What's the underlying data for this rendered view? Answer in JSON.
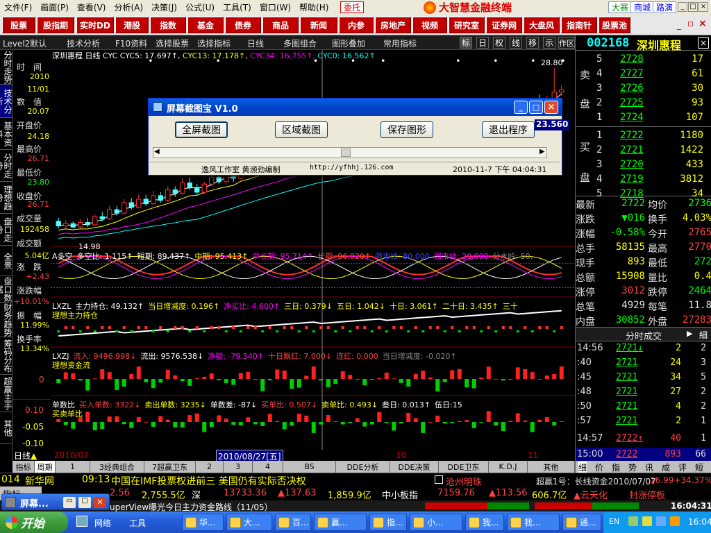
{
  "menu": {
    "items": [
      "文件(F)",
      "画面(P)",
      "查看(V)",
      "分析(A)",
      "决策(J)",
      "公式(U)",
      "工具(T)",
      "窗口(W)",
      "帮助(H)"
    ],
    "trade_btn": "委托",
    "app_title": "大智慧金融终端",
    "right_btns": [
      "大赛",
      "商城",
      "路演"
    ],
    "win_ctrls": [
      "_",
      "□",
      "×"
    ]
  },
  "modules": [
    "股票",
    "股指期",
    "实时DD",
    "港股",
    "指数",
    "基金",
    "债券",
    "商品",
    "新闻",
    "内参",
    "房地产",
    "视频",
    "研究室",
    "证券网",
    "大盘风",
    "指南针",
    "股票池"
  ],
  "toolbar2": {
    "items": [
      "Level2默认",
      "技术分析",
      "F10资料",
      "选择股票",
      "选择指标",
      "日线",
      "多图组合",
      "图形叠加",
      "常用指标"
    ],
    "square_btns": [
      "标",
      "日",
      "权",
      "线",
      "移",
      "示",
      "作区"
    ]
  },
  "left_tabs": [
    "分时走势",
    "技术分析",
    "基本资料",
    "分时走势",
    "理想趋势",
    "盘口走势",
    "全景",
    "盘口数据",
    "财务趋势",
    "筹码分布",
    "超赢主手",
    "其他"
  ],
  "info": {
    "labels": [
      "时　间",
      "数　值",
      "开盘价",
      "最高价",
      "最低价",
      "收盘价",
      "成交量",
      "成交额",
      "涨　跌",
      "涨跌幅",
      "振　幅",
      "换手率"
    ],
    "values": [
      "2010",
      "11/01",
      "20.07",
      "24.18",
      "26.71",
      "23.80",
      "26.71",
      "192458",
      "5.04亿",
      "+2.43",
      "+10.01%",
      "11.99%",
      "13.34%"
    ]
  },
  "chart_data": {
    "type": "candlestick",
    "title": "深圳惠程 日线",
    "indicators": [
      {
        "name": "CYC",
        "color": "#ffffff",
        "label": "CYC"
      },
      {
        "name": "CYC5",
        "value": "17.697",
        "color": "#ffffff"
      },
      {
        "name": "CYC13",
        "value": "17.178",
        "color": "#ffff00"
      },
      {
        "name": "CYC34",
        "value": "16.755",
        "color": "#ff00ff"
      },
      {
        "name": "CYC0",
        "value": "16.562",
        "color": "#00ffff"
      }
    ],
    "price_labels": [
      "28.80",
      "23.560",
      "14.98"
    ],
    "x_labels": [
      "2010/07",
      "2010/08/27[五]",
      "10",
      "11"
    ],
    "day_label": "日线",
    "candles": [
      [
        15.6,
        15.2,
        15.9,
        15.0
      ],
      [
        15.2,
        15.4,
        15.7,
        14.98
      ],
      [
        15.4,
        15.1,
        15.6,
        15.0
      ],
      [
        15.1,
        15.5,
        15.8,
        15.0
      ],
      [
        15.5,
        15.3,
        15.9,
        15.1
      ],
      [
        15.3,
        16.0,
        16.2,
        15.2
      ],
      [
        16.0,
        15.8,
        16.4,
        15.6
      ],
      [
        15.8,
        16.6,
        16.9,
        15.7
      ],
      [
        16.6,
        16.3,
        16.9,
        16.1
      ],
      [
        16.3,
        17.2,
        17.5,
        16.2
      ],
      [
        17.2,
        16.8,
        17.6,
        16.6
      ],
      [
        16.8,
        17.5,
        17.9,
        16.7
      ],
      [
        17.5,
        17.1,
        17.9,
        16.9
      ],
      [
        17.1,
        17.8,
        18.2,
        17.0
      ],
      [
        17.8,
        17.4,
        18.1,
        17.2
      ],
      [
        17.4,
        18.3,
        18.6,
        17.3
      ],
      [
        18.3,
        18.0,
        18.6,
        17.7
      ],
      [
        18.0,
        18.9,
        19.3,
        17.9
      ],
      [
        18.9,
        18.5,
        19.4,
        18.3
      ],
      [
        18.5,
        18.1,
        18.8,
        17.8
      ],
      [
        18.1,
        18.8,
        19.0,
        18.0
      ],
      [
        18.8,
        19.4,
        19.8,
        18.6
      ],
      [
        19.4,
        19.0,
        19.9,
        18.8
      ],
      [
        19.0,
        19.7,
        20.3,
        18.9
      ],
      [
        19.7,
        19.3,
        20.0,
        19.0
      ],
      [
        19.3,
        20.2,
        20.6,
        19.2
      ],
      [
        20.2,
        19.8,
        20.7,
        19.5
      ],
      [
        19.8,
        20.6,
        21.0,
        19.6
      ],
      [
        20.6,
        20.2,
        21.0,
        20.0
      ],
      [
        20.2,
        20.9,
        21.4,
        20.1
      ],
      [
        20.9,
        20.4,
        21.3,
        20.2
      ],
      [
        20.4,
        21.1,
        21.5,
        20.3
      ],
      [
        21.1,
        20.7,
        21.4,
        20.5
      ],
      [
        20.7,
        21.4,
        21.8,
        20.6
      ],
      [
        21.4,
        21.0,
        21.7,
        20.7
      ],
      [
        21.0,
        21.6,
        22.0,
        20.9
      ],
      [
        21.6,
        21.1,
        21.9,
        20.8
      ],
      [
        21.1,
        20.4,
        21.2,
        20.2
      ],
      [
        20.4,
        21.0,
        21.2,
        20.2
      ],
      [
        21.0,
        21.5,
        21.9,
        20.8
      ],
      [
        21.5,
        21.2,
        21.9,
        21.0
      ],
      [
        21.2,
        21.8,
        22.1,
        21.1
      ],
      [
        21.8,
        21.4,
        22.0,
        21.2
      ],
      [
        21.4,
        20.8,
        21.5,
        20.6
      ],
      [
        20.8,
        20.3,
        20.9,
        20.0
      ],
      [
        20.3,
        20.9,
        21.2,
        20.1
      ],
      [
        20.9,
        20.6,
        21.2,
        20.3
      ],
      [
        20.6,
        21.3,
        21.6,
        20.5
      ],
      [
        21.3,
        21.0,
        21.6,
        20.8
      ],
      [
        21.0,
        21.7,
        22.1,
        20.9
      ],
      [
        21.7,
        21.3,
        22.0,
        21.1
      ],
      [
        21.3,
        21.9,
        22.3,
        21.2
      ],
      [
        21.9,
        21.5,
        22.2,
        21.2
      ],
      [
        21.5,
        22.2,
        22.6,
        21.4
      ],
      [
        22.2,
        21.8,
        22.5,
        21.5
      ],
      [
        21.8,
        20.9,
        21.9,
        20.6
      ],
      [
        20.9,
        21.6,
        21.8,
        20.8
      ],
      [
        21.6,
        22.3,
        22.7,
        21.5
      ],
      [
        22.3,
        21.9,
        22.7,
        21.6
      ],
      [
        21.9,
        22.6,
        23.0,
        21.8
      ],
      [
        22.6,
        22.2,
        23.0,
        22.0
      ],
      [
        22.2,
        23.0,
        23.4,
        22.1
      ],
      [
        23.0,
        22.6,
        23.3,
        22.4
      ],
      [
        22.6,
        23.4,
        23.8,
        22.5
      ],
      [
        23.4,
        24.2,
        24.6,
        23.3
      ],
      [
        24.2,
        25.9,
        26.2,
        24.1
      ],
      [
        25.9,
        25.3,
        26.5,
        25.0
      ],
      [
        25.3,
        26.1,
        26.4,
        25.1
      ],
      [
        26.1,
        26.71,
        28.8,
        25.9
      ],
      [
        26.71,
        26.9,
        27.3,
        26.4
      ]
    ]
  },
  "panels": {
    "p1": {
      "title": "A多空",
      "items": [
        {
          "t": "多空比: 1.115↑",
          "c": "#fff"
        },
        {
          "t": "短期: 89.437↑",
          "c": "#fff"
        },
        {
          "t": "中期: 95.413↑",
          "c": "#ffff00"
        },
        {
          "t": "中长期: 95.714↑",
          "c": "#ff00ff"
        },
        {
          "t": "长期: 96.920↑",
          "c": "#ff4040"
        },
        {
          "t": "强市线: 80.000",
          "c": "#4040ff"
        },
        {
          "t": "弱市线: 20.000",
          "c": "#ff00ff"
        },
        {
          "t": "分水岭: 50.",
          "c": "#888"
        }
      ]
    },
    "p2": {
      "title": "LXZL",
      "sub": "理想主力持仓",
      "items": [
        {
          "t": "主力持仓: 49.132↑",
          "c": "#fff"
        },
        {
          "t": "当日增减度: 0.196↑",
          "c": "#ffff00"
        },
        {
          "t": "净买比: 4.600↑",
          "c": "#ff00ff"
        },
        {
          "t": "三日: 0.379↓",
          "c": "#ffff00"
        },
        {
          "t": "五日: 1.042↓",
          "c": "#ffff00"
        },
        {
          "t": "十日: 3.061↑",
          "c": "#ffff00"
        },
        {
          "t": "二十日: 3.435↑",
          "c": "#ffff00"
        },
        {
          "t": "三十",
          "c": "#ffff00"
        }
      ]
    },
    "p3": {
      "title": "LXZJ",
      "sub": "理想资金流",
      "items": [
        {
          "t": "流入: 9496.998↓",
          "c": "#ff4040"
        },
        {
          "t": "流出: 9576.538↓",
          "c": "#fff"
        },
        {
          "t": "净额: -79.540↑",
          "c": "#ff00ff"
        },
        {
          "t": "十日飘红: 7.000↓",
          "c": "#ff4040"
        },
        {
          "t": "连红: 0.000",
          "c": "#ff4040"
        },
        {
          "t": "当日增减度: -0.020↑",
          "c": "#888"
        }
      ],
      "zero": "0"
    },
    "p4": {
      "title": "单数比",
      "sub": "买卖单比",
      "items": [
        {
          "t": "买入单数: 3322↓",
          "c": "#ff4040"
        },
        {
          "t": "卖出单数: 3235↓",
          "c": "#ffff00"
        },
        {
          "t": "单数差: -87↓",
          "c": "#fff"
        },
        {
          "t": "买单比: 0.507↓",
          "c": "#ff4040"
        },
        {
          "t": "卖单比: 0.493↓",
          "c": "#ffff00"
        },
        {
          "t": "叁日: 0.013↑",
          "c": "#fff"
        },
        {
          "t": "伍日:15",
          "c": "#fff"
        }
      ],
      "y_labels": [
        "0.10",
        "-0.05",
        "-0.10"
      ]
    }
  },
  "right": {
    "code": "002168",
    "name": "深圳惠程",
    "sell_label": [
      "卖",
      "盘"
    ],
    "buy_label": [
      "买",
      "盘"
    ],
    "asks": [
      [
        "5",
        "2728",
        "17"
      ],
      [
        "4",
        "2727",
        "61"
      ],
      [
        "3",
        "2726",
        "30"
      ],
      [
        "2",
        "2725",
        "93"
      ],
      [
        "1",
        "2724",
        "107"
      ]
    ],
    "bids": [
      [
        "1",
        "2722",
        "1180"
      ],
      [
        "2",
        "2721",
        "1422"
      ],
      [
        "3",
        "2720",
        "433"
      ],
      [
        "4",
        "2719",
        "3812"
      ],
      [
        "5",
        "2718",
        "34"
      ]
    ],
    "stats": [
      [
        "最新",
        "2722",
        "均价",
        "2736"
      ],
      [
        "涨跌",
        "▼016",
        "换手",
        "4.03%"
      ],
      [
        "涨幅",
        "-0.58%",
        "今开",
        "2765"
      ],
      [
        "总手",
        "58135",
        "最高",
        "2770"
      ],
      [
        "现手",
        "893",
        "最低",
        "272"
      ],
      [
        "总额",
        "15908",
        "量比",
        "0.4"
      ],
      [
        "涨停",
        "3012",
        "跌停",
        "2464"
      ],
      [
        "总笔",
        "4929",
        "每笔",
        "11.8"
      ],
      [
        "内盘",
        "30852",
        "外盘",
        "27283"
      ]
    ],
    "trade_header": "分时成交",
    "trades": [
      [
        "14:56",
        "2721↓",
        "2",
        "2"
      ],
      [
        ":40",
        "2721",
        "24",
        "3"
      ],
      [
        ":45",
        "2721",
        "34",
        "5"
      ],
      [
        ":48",
        "2721",
        "27",
        "2"
      ],
      [
        ":50",
        "2721",
        "4",
        "2"
      ],
      [
        ":57",
        "2721",
        "2",
        "1"
      ],
      [
        "14:57",
        "2722↑",
        "40",
        "1"
      ],
      [
        "15:00",
        "2722",
        "893",
        "66"
      ]
    ],
    "bottom_tabs": [
      "细",
      "价",
      "指",
      "势",
      "讯",
      "成",
      "评",
      "短"
    ]
  },
  "dialog": {
    "title": "屏幕截图宝 V1.0",
    "buttons": [
      "全屏截图",
      "区域截图",
      "保存图形",
      "退出程序"
    ],
    "author": "逸风工作室 黄濒劲编制",
    "url": "http://yfhhj.126.com",
    "time": "2010-11-7 下午 04:04:31",
    "float_price": "23.560"
  },
  "bottom_tabs": [
    "指标",
    "周期",
    "1",
    "3经典组合",
    "7超赢卫东",
    "2",
    "3",
    "4",
    "BS",
    "DDE分析",
    "DDE决策",
    "DDE卫东",
    "K.D.J",
    "其他"
  ],
  "news": {
    "code": "014",
    "src": "新华网",
    "time": "09:13",
    "text": "中国在IMF投票权进前三 美国仍有实际否决权",
    "stock": "沧州明珠",
    "right": "超赢1号：长线资金2010/07/07",
    "pct": "16.99+34.37%"
  },
  "ticker": [
    "2.56",
    "2,755.5亿",
    "深",
    "13733.36",
    "▲137.63",
    "1,859.9亿",
    "中小板指",
    "7159.76",
    "▲113.56",
    "606.7亿",
    "▲云天化",
    "封涨停板"
  ],
  "ticker2": {
    "left": "uperView曝光今日主力资金路线（11/05）",
    "time": "16:04:31"
  },
  "taskbar": {
    "start": "开始",
    "popup": "屏幕...",
    "quick": [
      "网络",
      "工具"
    ],
    "tasks": [
      "华...",
      "大...",
      "百...",
      "赢...",
      "指...",
      "小...",
      "我...",
      "我...",
      "通..."
    ],
    "tray_time": "16:04",
    "lang": "EN"
  }
}
